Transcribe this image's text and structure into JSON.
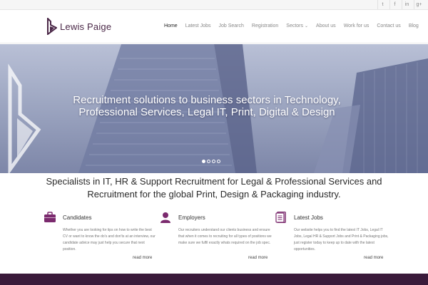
{
  "social": [
    {
      "icon": "twitter-icon",
      "glyph": "t"
    },
    {
      "icon": "facebook-icon",
      "glyph": "f"
    },
    {
      "icon": "linkedin-icon",
      "glyph": "in"
    },
    {
      "icon": "googleplus-icon",
      "glyph": "g+"
    }
  ],
  "brand": {
    "name": "Lewis Paige",
    "color": "#4a2747"
  },
  "nav": [
    {
      "label": "Home",
      "active": true
    },
    {
      "label": "Latest Jobs"
    },
    {
      "label": "Job Search"
    },
    {
      "label": "Registration"
    },
    {
      "label": "Sectors",
      "dropdown": true
    },
    {
      "label": "About us"
    },
    {
      "label": "Work for us"
    },
    {
      "label": "Contact us"
    },
    {
      "label": "Blog"
    }
  ],
  "hero": {
    "title": "Recruitment solutions to business sectors in Technology, Professional Services, Legal IT, Print, Digital & Design",
    "slides": 4,
    "active_slide": 1
  },
  "intro": "Specialists in IT, HR & Support Recruitment for Legal & Professional Services and Recruitment for the global Print, Design & Packaging industry.",
  "columns": [
    {
      "icon": "briefcase-icon",
      "title": "Candidates",
      "body": "Whether you are looking for tips on how to write the best CV or want to know the do's and don'ts at an interview, our candidate advice may just help you secure that next position.",
      "link": "read more"
    },
    {
      "icon": "user-icon",
      "title": "Employers",
      "body": "Our recruiters understand our clients business and ensure that when it comes to recruiting for all types of positions we make sure we fulfil exactly whats required on the job spec.",
      "link": "read more"
    },
    {
      "icon": "document-icon",
      "title": "Latest Jobs",
      "body": "Our website helps you to find the latest IT Jobs, Legal IT Jobs, Legal HR & Support Jobs and Print & Packaging jobs, just register today to keep up to date with the latest opportunities.",
      "link": "read more"
    }
  ],
  "colors": {
    "accent": "#7b2a6e",
    "footer": "#3a1a3a"
  }
}
